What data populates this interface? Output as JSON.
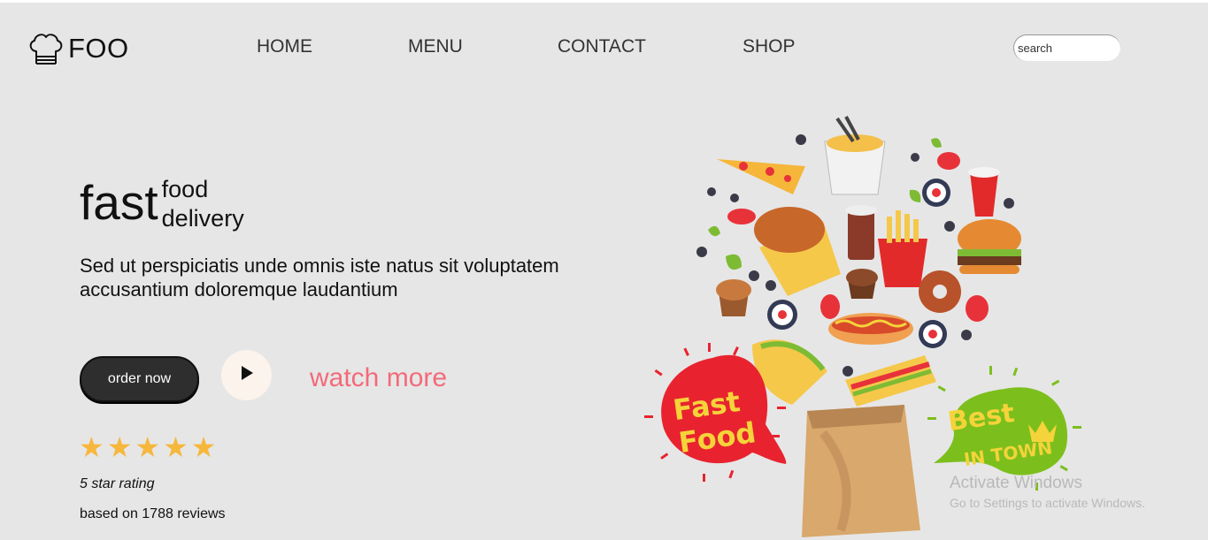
{
  "header": {
    "logo_text": "FOO",
    "nav": [
      {
        "label": "HOME"
      },
      {
        "label": "MENU"
      },
      {
        "label": "CONTACT"
      },
      {
        "label": "SHOP"
      }
    ],
    "search_placeholder": "search"
  },
  "hero": {
    "title_big": "fast",
    "title_small_1": "food",
    "title_small_2": "delivery",
    "description": "Sed ut perspiciatis unde omnis iste natus sit voluptatem accusantium doloremque laudantium",
    "order_button": "order now",
    "watch_more": "watch more",
    "star_rating_value": 5,
    "rating_label": "5 star rating",
    "reviews_label": "based on 1788 reviews"
  },
  "illustration": {
    "badge_left": [
      "Fast",
      "Food"
    ],
    "badge_right": [
      "Best",
      "IN TOWN"
    ]
  },
  "os_watermark": {
    "title": "Activate Windows",
    "subtitle": "Go to Settings to activate Windows."
  },
  "colors": {
    "background": "#e6e6e6",
    "accent_pink": "#f36a7a",
    "star": "#f6b73c",
    "button_dark": "#2e2e2e"
  }
}
